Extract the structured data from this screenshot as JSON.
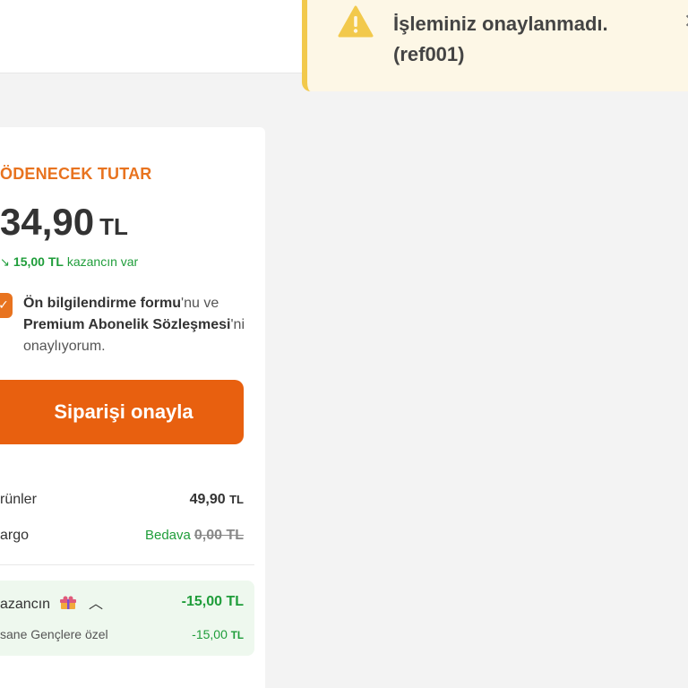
{
  "toast": {
    "line1": "İşleminiz onaylanmadı.",
    "line2": "(ref001)",
    "icon": "warning-icon",
    "close_icon": "close-icon",
    "accent_color": "#f2c94c",
    "background_color": "#fdf7e6"
  },
  "summary": {
    "title": "ÖDENECEK TUTAR",
    "amount": "34,90",
    "currency": "TL",
    "gain_amount": "15,00",
    "gain_currency": "TL",
    "gain_text": "kazancın var",
    "consent": {
      "link1": "Ön bilgilendirme formu",
      "text1": "'nu ve",
      "link2": "Premium Abonelik Sözleşmesi",
      "text2": "'ni onaylıyorum.",
      "checked": true
    },
    "confirm_button": "Siparişi onayla",
    "rows": [
      {
        "label": "rünler",
        "value": "49,90",
        "currency": "TL"
      },
      {
        "label": "argo",
        "free": "Bedava",
        "old_value": "0,00 TL"
      }
    ],
    "gains": {
      "label": "azancın",
      "total": "-15,00 TL",
      "item_label": "sane Gençlere özel",
      "item_value": "-15,00",
      "item_currency": "TL"
    },
    "accent_color": "#e8600f",
    "success_color": "#1f9d3a"
  }
}
